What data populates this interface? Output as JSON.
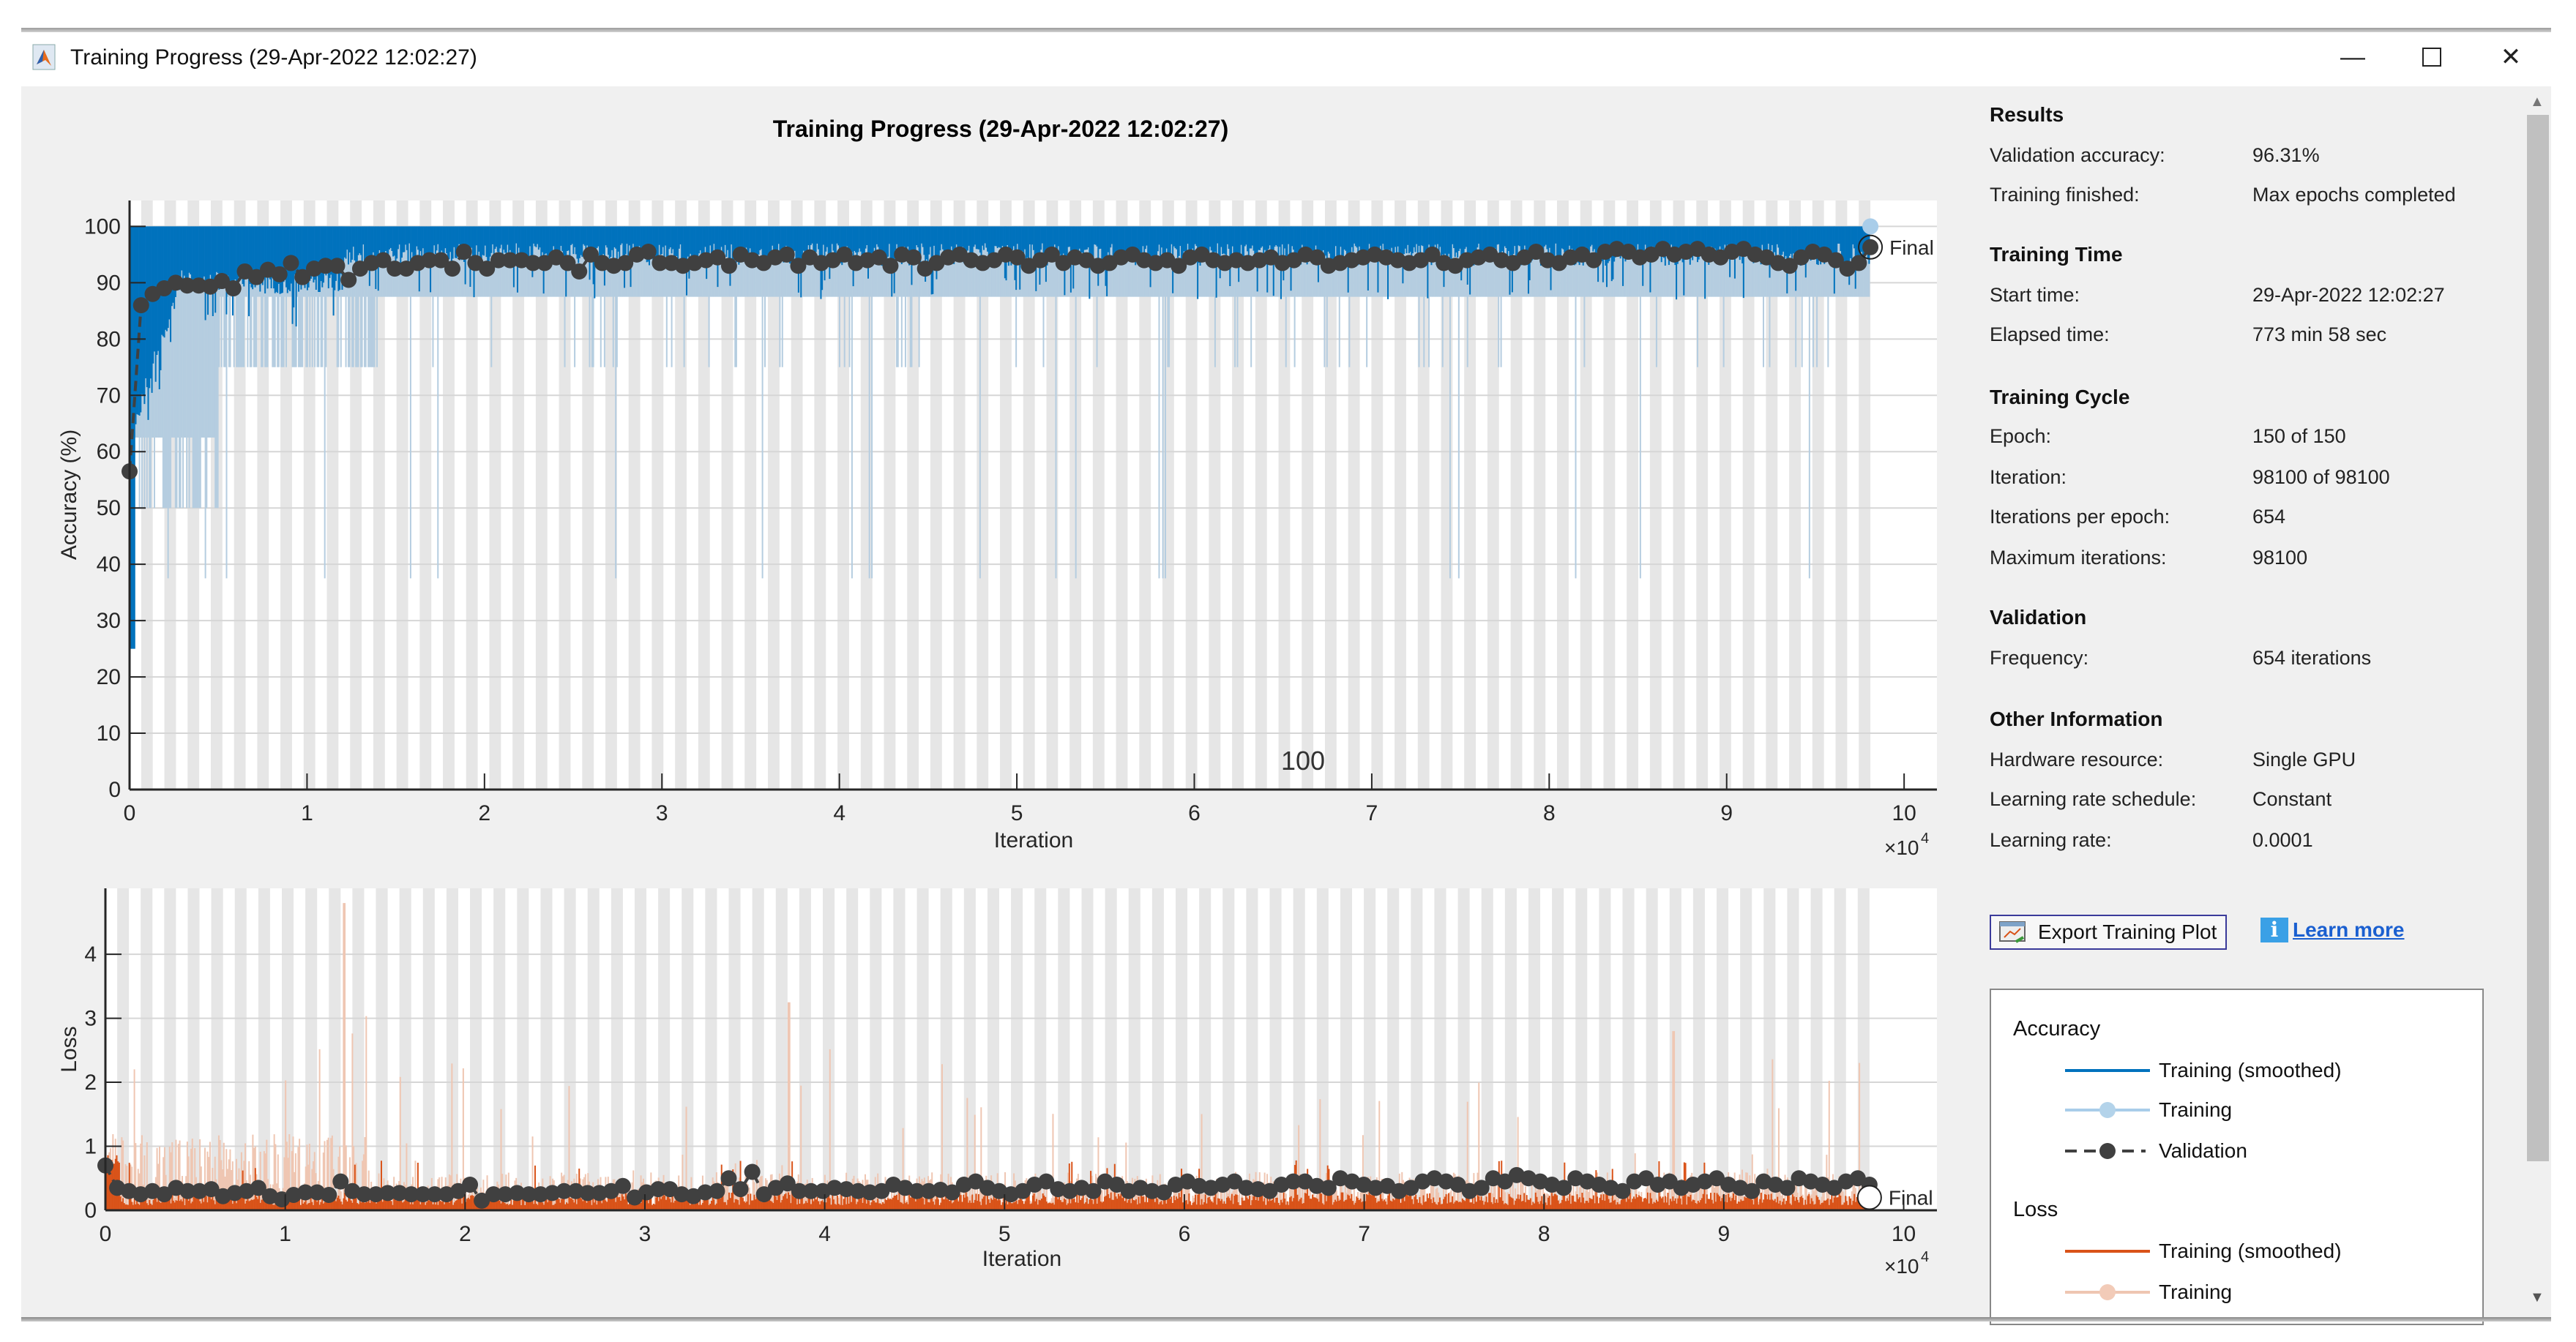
{
  "window": {
    "title": "Training Progress (29-Apr-2022 12:02:27)",
    "minimize_icon": "minimize-icon",
    "maximize_icon": "maximize-icon",
    "close_icon": "close-icon"
  },
  "plot_title": "Training Progress (29-Apr-2022 12:02:27)",
  "panel": {
    "results": {
      "heading": "Results",
      "rows": [
        {
          "label": "Validation accuracy:",
          "value": "96.31%"
        },
        {
          "label": "Training finished:",
          "value": "Max epochs completed"
        }
      ]
    },
    "training_time": {
      "heading": "Training Time",
      "rows": [
        {
          "label": "Start time:",
          "value": "29-Apr-2022 12:02:27"
        },
        {
          "label": "Elapsed time:",
          "value": "773 min 58 sec"
        }
      ]
    },
    "training_cycle": {
      "heading": "Training Cycle",
      "rows": [
        {
          "label": "Epoch:",
          "value": "150 of 150"
        },
        {
          "label": "Iteration:",
          "value": "98100 of 98100"
        },
        {
          "label": "Iterations per epoch:",
          "value": "654"
        },
        {
          "label": "Maximum iterations:",
          "value": "98100"
        }
      ]
    },
    "validation": {
      "heading": "Validation",
      "rows": [
        {
          "label": "Frequency:",
          "value": "654 iterations"
        }
      ]
    },
    "other": {
      "heading": "Other Information",
      "rows": [
        {
          "label": "Hardware resource:",
          "value": "Single GPU"
        },
        {
          "label": "Learning rate schedule:",
          "value": "Constant"
        },
        {
          "label": "Learning rate:",
          "value": "0.0001"
        }
      ]
    },
    "export_button": "Export Training Plot",
    "learn_more": "Learn more"
  },
  "legend": {
    "accuracy_heading": "Accuracy",
    "acc_smoothed": "Training (smoothed)",
    "acc_training": "Training",
    "acc_validation": "Validation",
    "loss_heading": "Loss",
    "loss_smoothed": "Training (smoothed)",
    "loss_training": "Training"
  },
  "colors": {
    "acc_smoothed": "#0072bd",
    "acc_training": "#b5cde0",
    "validation": "#404040",
    "loss_smoothed": "#d95319",
    "loss_training": "#efc6b2",
    "epoch_band": "#e6e6e6"
  },
  "chart_data": [
    {
      "type": "line",
      "title": "Training Progress (29-Apr-2022 12:02:27)",
      "ylabel": "Accuracy (%)",
      "xlabel": "Iteration",
      "x_exponent_label": "×10",
      "x_exponent": "4",
      "xlim": [
        0,
        101850
      ],
      "ylim": [
        0,
        104.6
      ],
      "xticks": [
        0,
        1,
        2,
        3,
        4,
        5,
        6,
        7,
        8,
        9,
        10
      ],
      "yticks": [
        0,
        10,
        20,
        30,
        40,
        50,
        60,
        70,
        80,
        90,
        100
      ],
      "grid": true,
      "annotation": "100",
      "final_label": "Final",
      "iterations_per_epoch": 654,
      "epochs": 150,
      "validation_frequency": 654,
      "series": [
        {
          "name": "Validation",
          "values": [
            56.5,
            86,
            88,
            89,
            90,
            89.5,
            89.5,
            89.3,
            90.3,
            89,
            92,
            91,
            92.3,
            91.5,
            93.5,
            91,
            92.5,
            93,
            93,
            90.5,
            92.5,
            93.5,
            94,
            92.5,
            92.5,
            93.5,
            94,
            94,
            92.5,
            95.5,
            93.5,
            92.5,
            94,
            94,
            94,
            93.5,
            93.5,
            94.5,
            93.5,
            92,
            95,
            93.5,
            93,
            93.5,
            95,
            95.5,
            93.5,
            93.5,
            93,
            93.5,
            94,
            94.5,
            93,
            95,
            94,
            93.5,
            94.5,
            95,
            93,
            94.5,
            93.5,
            94,
            95,
            93.5,
            94,
            94.5,
            93,
            95,
            94.5,
            92.5,
            93.5,
            94.5,
            95,
            94,
            93.5,
            94,
            95,
            94.5,
            93,
            94,
            95,
            93.5,
            94.5,
            94,
            93,
            93.5,
            94.5,
            95,
            94,
            93.5,
            94,
            93,
            94.5,
            95,
            94,
            93.5,
            94,
            93.5,
            94,
            94.5,
            93.5,
            94,
            95,
            94.5,
            93,
            93.5,
            94,
            94.5,
            95,
            94.5,
            94,
            93.5,
            94,
            95,
            93.5,
            93,
            94,
            94.5,
            95,
            94,
            93.5,
            94.5,
            95.5,
            94,
            93.5,
            94.5,
            95,
            94,
            95.5,
            96,
            95.5,
            94.5,
            95,
            96,
            95,
            95.5,
            96,
            95,
            94.5,
            95.5,
            96,
            95,
            94.5,
            93.5,
            93,
            94.5,
            95.5,
            95,
            94,
            92.5,
            93.5,
            96.31
          ]
        }
      ]
    },
    {
      "type": "line",
      "ylabel": "Loss",
      "xlabel": "Iteration",
      "x_exponent_label": "×10",
      "x_exponent": "4",
      "xlim": [
        0,
        101850
      ],
      "ylim": [
        0,
        5.03
      ],
      "xticks": [
        0,
        1,
        2,
        3,
        4,
        5,
        6,
        7,
        8,
        9,
        10
      ],
      "yticks": [
        0,
        1,
        2,
        3,
        4
      ],
      "grid": true,
      "final_label": "Final",
      "series": [
        {
          "name": "Validation",
          "values": [
            0.7,
            0.35,
            0.3,
            0.25,
            0.3,
            0.25,
            0.35,
            0.3,
            0.3,
            0.33,
            0.22,
            0.27,
            0.3,
            0.35,
            0.22,
            0.17,
            0.24,
            0.28,
            0.28,
            0.24,
            0.45,
            0.3,
            0.25,
            0.25,
            0.27,
            0.27,
            0.25,
            0.25,
            0.25,
            0.25,
            0.3,
            0.4,
            0.15,
            0.25,
            0.25,
            0.27,
            0.25,
            0.25,
            0.27,
            0.3,
            0.3,
            0.27,
            0.27,
            0.3,
            0.38,
            0.2,
            0.28,
            0.33,
            0.33,
            0.25,
            0.22,
            0.28,
            0.3,
            0.5,
            0.33,
            0.6,
            0.25,
            0.35,
            0.42,
            0.3,
            0.3,
            0.3,
            0.35,
            0.33,
            0.3,
            0.28,
            0.3,
            0.4,
            0.35,
            0.3,
            0.3,
            0.32,
            0.28,
            0.4,
            0.45,
            0.35,
            0.3,
            0.25,
            0.3,
            0.4,
            0.45,
            0.33,
            0.3,
            0.35,
            0.3,
            0.45,
            0.4,
            0.3,
            0.35,
            0.3,
            0.28,
            0.4,
            0.45,
            0.38,
            0.35,
            0.4,
            0.45,
            0.35,
            0.33,
            0.3,
            0.4,
            0.45,
            0.45,
            0.38,
            0.35,
            0.5,
            0.45,
            0.4,
            0.35,
            0.38,
            0.3,
            0.35,
            0.45,
            0.5,
            0.45,
            0.4,
            0.3,
            0.35,
            0.5,
            0.45,
            0.55,
            0.5,
            0.45,
            0.4,
            0.35,
            0.5,
            0.45,
            0.4,
            0.35,
            0.3,
            0.45,
            0.5,
            0.4,
            0.45,
            0.35,
            0.4,
            0.45,
            0.5,
            0.4,
            0.35,
            0.3,
            0.45,
            0.4,
            0.35,
            0.5,
            0.45,
            0.4,
            0.35,
            0.45,
            0.5,
            0.4
          ]
        }
      ]
    }
  ]
}
